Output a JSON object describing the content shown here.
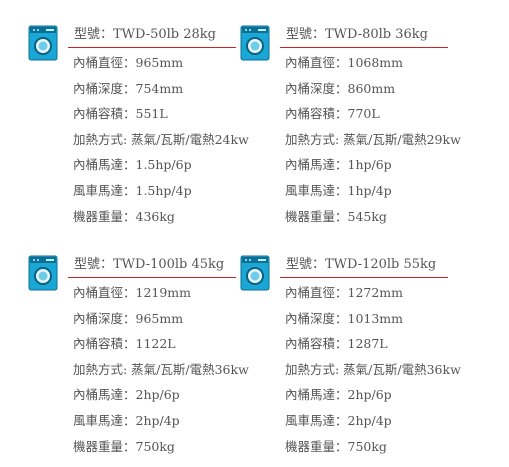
{
  "colors": {
    "accent_line": "#cc2222",
    "text": "#555555",
    "icon_body": "#1aa7d6",
    "icon_dark": "#0d6f94"
  },
  "products": [
    {
      "icon": "washer-icon",
      "title": "型號：TWD-50lb 28kg",
      "specs": [
        "內桶直徑：965mm",
        "內桶深度：754mm",
        "內桶容積：551L",
        "加熱方式: 蒸氣/瓦斯/電熱24kw",
        "內桶馬達：1.5hp/6p",
        "風車馬達：1.5hp/4p",
        "機器重量：436kg"
      ]
    },
    {
      "icon": "washer-icon",
      "title": "型號：TWD-80lb 36kg",
      "specs": [
        "內桶直徑：1068mm",
        "內桶深度：860mm",
        "內桶容積：770L",
        "加熱方式: 蒸氣/瓦斯/電熱29kw",
        "內桶馬達：1hp/6p",
        "風車馬達：1hp/4p",
        "機器重量：545kg"
      ]
    },
    {
      "icon": "washer-icon",
      "title": "型號：TWD-100lb 45kg",
      "specs": [
        "內桶直徑：1219mm",
        "內桶深度：965mm",
        "內桶容積：1122L",
        "加熱方式: 蒸氣/瓦斯/電熱36kw",
        "內桶馬達：2hp/6p",
        "風車馬達：2hp/4p",
        "機器重量：750kg"
      ]
    },
    {
      "icon": "washer-icon",
      "title": "型號：TWD-120lb 55kg",
      "specs": [
        "內桶直徑：1272mm",
        "內桶深度：1013mm",
        "內桶容積：1287L",
        "加熱方式: 蒸氣/瓦斯/電熱36kw",
        "內桶馬達：2hp/6p",
        "風車馬達：2hp/4p",
        "機器重量：750kg"
      ]
    }
  ]
}
